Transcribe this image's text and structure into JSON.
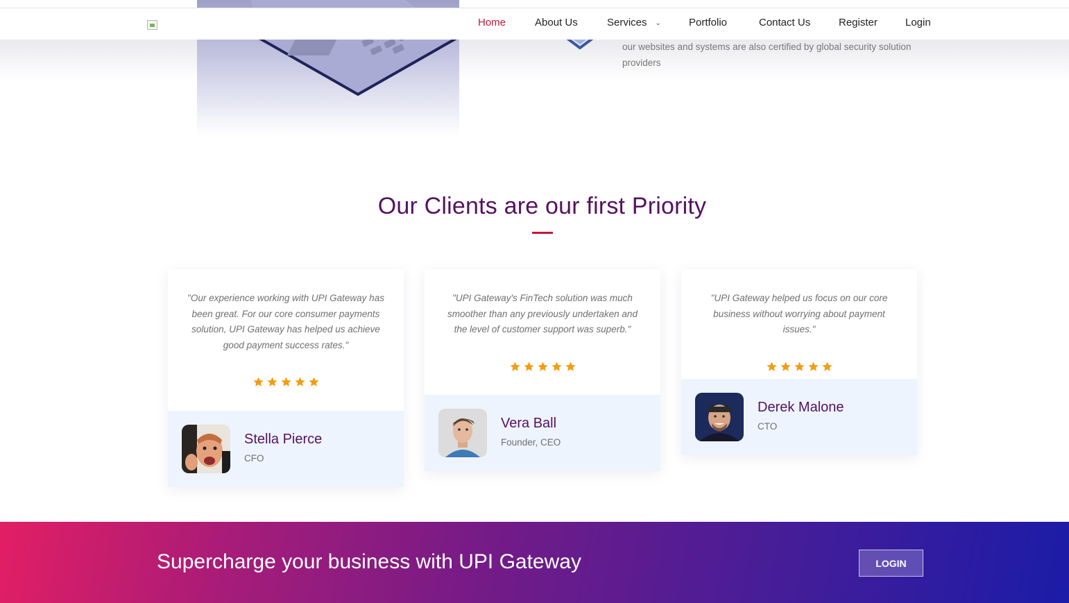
{
  "nav": {
    "items": [
      {
        "label": "Home",
        "active": true
      },
      {
        "label": "About Us"
      },
      {
        "label": "Services",
        "has_dropdown": true
      },
      {
        "label": "Portfolio"
      },
      {
        "label": "Contact Us"
      },
      {
        "label": "Register"
      },
      {
        "label": "Login"
      }
    ],
    "active_color": "#c5163a"
  },
  "security": {
    "text": "our websites and systems are also certified by global security solution providers"
  },
  "clients": {
    "heading": "Our Clients are our first Priority",
    "testimonials": [
      {
        "quote": "\"Our experience working with UPI Gateway has been great. For our core consumer payments solution, UPI Gateway has helped us achieve good payment success rates.\"",
        "rating": 5,
        "name": "Stella Pierce",
        "role": "CFO"
      },
      {
        "quote": "\"UPI Gateway's FinTech solution was much smoother than any previously undertaken and the level of customer support was superb.\"",
        "rating": 5,
        "name": "Vera Ball",
        "role": "Founder, CEO"
      },
      {
        "quote": "\"UPI Gateway helped us focus on our core business without worrying about payment issues.\"",
        "rating": 5,
        "name": "Derek Malone",
        "role": "CTO"
      }
    ]
  },
  "cta": {
    "text": "Supercharge your business with UPI Gateway",
    "button_label": "LOGIN"
  },
  "colors": {
    "heading": "#55125f",
    "accent": "#c5163a",
    "star": "#f39c12",
    "author_bg": "#edf4fd"
  },
  "icons": [
    "broken-image-icon",
    "laptop-illustration",
    "shield-icon",
    "star-icon",
    "chevron-down-icon"
  ]
}
